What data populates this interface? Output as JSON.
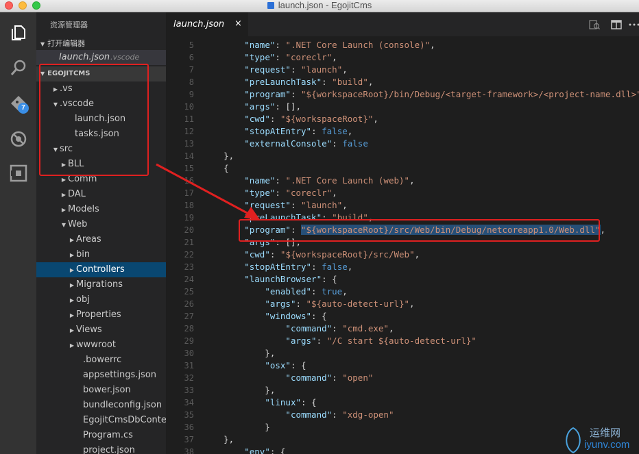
{
  "window": {
    "title": "launch.json - EgojitCms"
  },
  "activity": {
    "git_badge": "7"
  },
  "sidebar": {
    "title": "资源管理器",
    "open_editors_label": "打开编辑器",
    "open_file_name": "launch.json",
    "open_file_path": ".vscode",
    "project_label": "EGOJITCMS",
    "tree": [
      {
        "label": ".vs",
        "arrow": "▶"
      },
      {
        "label": ".vscode",
        "arrow": "▼"
      },
      {
        "label": "launch.json",
        "arrow": ""
      },
      {
        "label": "tasks.json",
        "arrow": ""
      },
      {
        "label": "src",
        "arrow": "▼"
      },
      {
        "label": "BLL",
        "arrow": "▶"
      },
      {
        "label": "Comm",
        "arrow": "▶"
      },
      {
        "label": "DAL",
        "arrow": "▶"
      },
      {
        "label": "Models",
        "arrow": "▶"
      },
      {
        "label": "Web",
        "arrow": "▼"
      },
      {
        "label": "Areas",
        "arrow": "▶"
      },
      {
        "label": "bin",
        "arrow": "▶"
      },
      {
        "label": "Controllers",
        "arrow": "▶"
      },
      {
        "label": "Migrations",
        "arrow": "▶"
      },
      {
        "label": "obj",
        "arrow": "▶"
      },
      {
        "label": "Properties",
        "arrow": "▶"
      },
      {
        "label": "Views",
        "arrow": "▶"
      },
      {
        "label": "wwwroot",
        "arrow": "▶"
      },
      {
        "label": ".bowerrc",
        "arrow": ""
      },
      {
        "label": "appsettings.json",
        "arrow": ""
      },
      {
        "label": "bower.json",
        "arrow": ""
      },
      {
        "label": "bundleconfig.json",
        "arrow": ""
      },
      {
        "label": "EgojitCmsDbContext.cs",
        "arrow": ""
      },
      {
        "label": "Program.cs",
        "arrow": ""
      },
      {
        "label": "project.json",
        "arrow": ""
      }
    ],
    "selected_item": "Controllers"
  },
  "tabs": [
    {
      "label": "launch.json",
      "close": "×"
    }
  ],
  "editor": {
    "lines": [
      {
        "n": "5",
        "tokens": [
          [
            "p",
            "        "
          ],
          [
            "k",
            "\"name\""
          ],
          [
            "p",
            ": "
          ],
          [
            "s",
            "\".NET Core Launch (console)\""
          ],
          [
            "p",
            ","
          ]
        ]
      },
      {
        "n": "6",
        "tokens": [
          [
            "p",
            "        "
          ],
          [
            "k",
            "\"type\""
          ],
          [
            "p",
            ": "
          ],
          [
            "s",
            "\"coreclr\""
          ],
          [
            "p",
            ","
          ]
        ]
      },
      {
        "n": "7",
        "tokens": [
          [
            "p",
            "        "
          ],
          [
            "k",
            "\"request\""
          ],
          [
            "p",
            ": "
          ],
          [
            "s",
            "\"launch\""
          ],
          [
            "p",
            ","
          ]
        ]
      },
      {
        "n": "8",
        "tokens": [
          [
            "p",
            "        "
          ],
          [
            "k",
            "\"preLaunchTask\""
          ],
          [
            "p",
            ": "
          ],
          [
            "s",
            "\"build\""
          ],
          [
            "p",
            ","
          ]
        ]
      },
      {
        "n": "9",
        "tokens": [
          [
            "p",
            "        "
          ],
          [
            "k",
            "\"program\""
          ],
          [
            "p",
            ": "
          ],
          [
            "s",
            "\"${workspaceRoot}/bin/Debug/<target-framework>/<project-name.dll>\""
          ],
          [
            "p",
            ","
          ]
        ]
      },
      {
        "n": "10",
        "tokens": [
          [
            "p",
            "        "
          ],
          [
            "k",
            "\"args\""
          ],
          [
            "p",
            ": [],"
          ]
        ]
      },
      {
        "n": "11",
        "tokens": [
          [
            "p",
            "        "
          ],
          [
            "k",
            "\"cwd\""
          ],
          [
            "p",
            ": "
          ],
          [
            "s",
            "\"${workspaceRoot}\""
          ],
          [
            "p",
            ","
          ]
        ]
      },
      {
        "n": "12",
        "tokens": [
          [
            "p",
            "        "
          ],
          [
            "k",
            "\"stopAtEntry\""
          ],
          [
            "p",
            ": "
          ],
          [
            "b",
            "false"
          ],
          [
            "p",
            ","
          ]
        ]
      },
      {
        "n": "13",
        "tokens": [
          [
            "p",
            "        "
          ],
          [
            "k",
            "\"externalConsole\""
          ],
          [
            "p",
            ": "
          ],
          [
            "b",
            "false"
          ]
        ]
      },
      {
        "n": "14",
        "tokens": [
          [
            "p",
            "    },"
          ]
        ]
      },
      {
        "n": "15",
        "tokens": [
          [
            "p",
            "    {"
          ]
        ]
      },
      {
        "n": "16",
        "tokens": [
          [
            "p",
            "        "
          ],
          [
            "k",
            "\"name\""
          ],
          [
            "p",
            ": "
          ],
          [
            "s",
            "\".NET Core Launch (web)\""
          ],
          [
            "p",
            ","
          ]
        ]
      },
      {
        "n": "17",
        "tokens": [
          [
            "p",
            "        "
          ],
          [
            "k",
            "\"type\""
          ],
          [
            "p",
            ": "
          ],
          [
            "s",
            "\"coreclr\""
          ],
          [
            "p",
            ","
          ]
        ]
      },
      {
        "n": "18",
        "tokens": [
          [
            "p",
            "        "
          ],
          [
            "k",
            "\"request\""
          ],
          [
            "p",
            ": "
          ],
          [
            "s",
            "\"launch\""
          ],
          [
            "p",
            ","
          ]
        ]
      },
      {
        "n": "19",
        "tokens": [
          [
            "p",
            "        "
          ],
          [
            "k",
            "\"preLaunchTask\""
          ],
          [
            "p",
            ": "
          ],
          [
            "s",
            "\"build\""
          ],
          [
            "p",
            ","
          ]
        ]
      },
      {
        "n": "20",
        "tokens": [
          [
            "p",
            "        "
          ],
          [
            "k",
            "\"program\""
          ],
          [
            "p",
            ": "
          ],
          [
            "hl",
            "\"${workspaceRoot}/src/Web/bin/Debug/netcoreapp1.0/Web.dll\""
          ],
          [
            "p",
            ","
          ]
        ]
      },
      {
        "n": "21",
        "tokens": [
          [
            "p",
            "        "
          ],
          [
            "k",
            "\"args\""
          ],
          [
            "p",
            ": [],"
          ]
        ]
      },
      {
        "n": "22",
        "tokens": [
          [
            "p",
            "        "
          ],
          [
            "k",
            "\"cwd\""
          ],
          [
            "p",
            ": "
          ],
          [
            "s",
            "\"${workspaceRoot}/src/Web\""
          ],
          [
            "p",
            ","
          ]
        ]
      },
      {
        "n": "23",
        "tokens": [
          [
            "p",
            "        "
          ],
          [
            "k",
            "\"stopAtEntry\""
          ],
          [
            "p",
            ": "
          ],
          [
            "b",
            "false"
          ],
          [
            "p",
            ","
          ]
        ]
      },
      {
        "n": "24",
        "tokens": [
          [
            "p",
            "        "
          ],
          [
            "k",
            "\"launchBrowser\""
          ],
          [
            "p",
            ": {"
          ]
        ]
      },
      {
        "n": "25",
        "tokens": [
          [
            "p",
            "            "
          ],
          [
            "k",
            "\"enabled\""
          ],
          [
            "p",
            ": "
          ],
          [
            "b",
            "true"
          ],
          [
            "p",
            ","
          ]
        ]
      },
      {
        "n": "26",
        "tokens": [
          [
            "p",
            "            "
          ],
          [
            "k",
            "\"args\""
          ],
          [
            "p",
            ": "
          ],
          [
            "s",
            "\"${auto-detect-url}\""
          ],
          [
            "p",
            ","
          ]
        ]
      },
      {
        "n": "27",
        "tokens": [
          [
            "p",
            "            "
          ],
          [
            "k",
            "\"windows\""
          ],
          [
            "p",
            ": {"
          ]
        ]
      },
      {
        "n": "28",
        "tokens": [
          [
            "p",
            "                "
          ],
          [
            "k",
            "\"command\""
          ],
          [
            "p",
            ": "
          ],
          [
            "s",
            "\"cmd.exe\""
          ],
          [
            "p",
            ","
          ]
        ]
      },
      {
        "n": "29",
        "tokens": [
          [
            "p",
            "                "
          ],
          [
            "k",
            "\"args\""
          ],
          [
            "p",
            ": "
          ],
          [
            "s",
            "\"/C start ${auto-detect-url}\""
          ]
        ]
      },
      {
        "n": "30",
        "tokens": [
          [
            "p",
            "            },"
          ]
        ]
      },
      {
        "n": "31",
        "tokens": [
          [
            "p",
            "            "
          ],
          [
            "k",
            "\"osx\""
          ],
          [
            "p",
            ": {"
          ]
        ]
      },
      {
        "n": "32",
        "tokens": [
          [
            "p",
            "                "
          ],
          [
            "k",
            "\"command\""
          ],
          [
            "p",
            ": "
          ],
          [
            "s",
            "\"open\""
          ]
        ]
      },
      {
        "n": "33",
        "tokens": [
          [
            "p",
            "            },"
          ]
        ]
      },
      {
        "n": "34",
        "tokens": [
          [
            "p",
            "            "
          ],
          [
            "k",
            "\"linux\""
          ],
          [
            "p",
            ": {"
          ]
        ]
      },
      {
        "n": "35",
        "tokens": [
          [
            "p",
            "                "
          ],
          [
            "k",
            "\"command\""
          ],
          [
            "p",
            ": "
          ],
          [
            "s",
            "\"xdg-open\""
          ]
        ]
      },
      {
        "n": "36",
        "tokens": [
          [
            "p",
            "            }"
          ]
        ]
      },
      {
        "n": "37",
        "tokens": [
          [
            "p",
            "    },"
          ]
        ]
      },
      {
        "n": "38",
        "tokens": [
          [
            "p",
            "        "
          ],
          [
            "k",
            "\"env\""
          ],
          [
            "p",
            ": {"
          ]
        ]
      }
    ]
  },
  "watermark": {
    "cn": "运维网",
    "url": "iyunv.com"
  },
  "colors": {
    "accent": "#3a8ee6",
    "annotation": "#e02020",
    "selection": "#094771"
  }
}
